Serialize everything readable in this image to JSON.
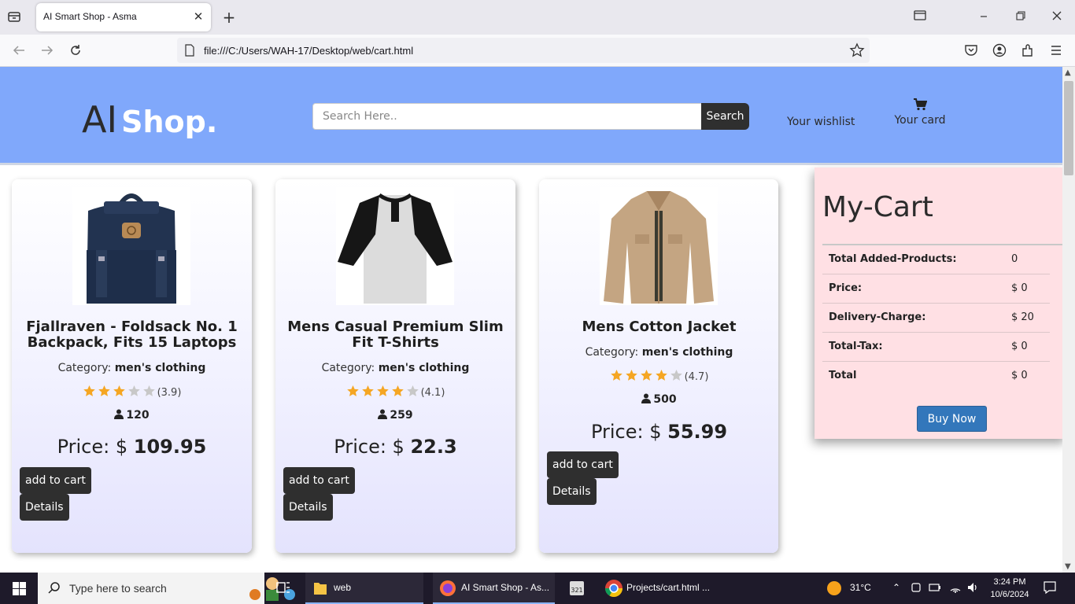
{
  "browser": {
    "tab_title": "AI Smart Shop - Asma",
    "url": "file:///C:/Users/WAH-17/Desktop/web/cart.html"
  },
  "header": {
    "logo_ai": "AI",
    "logo_shop": "Shop.",
    "search_placeholder": "Search Here..",
    "search_button": "Search",
    "wishlist": "Your wishlist",
    "cart": "Your card"
  },
  "products": [
    {
      "title": "Fjallraven - Foldsack No. 1 Backpack, Fits 15 Laptops",
      "category_label": "Category:",
      "category": "men's clothing",
      "rating": 3.9,
      "rating_text": "(3.9)",
      "count": "120",
      "price_label": "Price: $",
      "price": "109.95",
      "add_to_cart": "add to cart",
      "details": "Details"
    },
    {
      "title": "Mens Casual Premium Slim Fit T-Shirts",
      "category_label": "Category:",
      "category": "men's clothing",
      "rating": 4.1,
      "rating_text": "(4.1)",
      "count": "259",
      "price_label": "Price: $",
      "price": "22.3",
      "add_to_cart": "add to cart",
      "details": "Details"
    },
    {
      "title": "Mens Cotton Jacket",
      "category_label": "Category:",
      "category": "men's clothing",
      "rating": 4.7,
      "rating_text": "(4.7)",
      "count": "500",
      "price_label": "Price: $",
      "price": "55.99",
      "add_to_cart": "add to cart",
      "details": "Details"
    }
  ],
  "cart": {
    "title": "My-Cart",
    "rows": [
      {
        "label": "Total Added-Products:",
        "value": "0"
      },
      {
        "label": "Price:",
        "value": "$ 0"
      },
      {
        "label": "Delivery-Charge:",
        "value": "$ 20"
      },
      {
        "label": "Total-Tax:",
        "value": "$ 0"
      },
      {
        "label": "Total",
        "value": "$ 0"
      }
    ],
    "buy_now": "Buy Now"
  },
  "taskbar": {
    "search_text": "Type here to search",
    "items": [
      {
        "label": "web"
      },
      {
        "label": "AI Smart Shop - As..."
      },
      {
        "label": "Projects/cart.html ..."
      }
    ],
    "temperature": "31°C",
    "time": "3:24 PM",
    "date": "10/6/2024"
  },
  "colors": {
    "header_bg": "#80a8fb",
    "cart_bg": "#ffe0e4",
    "buy_button": "#3377bb",
    "star_filled": "#f5a623",
    "star_empty": "#c8c8c8"
  }
}
